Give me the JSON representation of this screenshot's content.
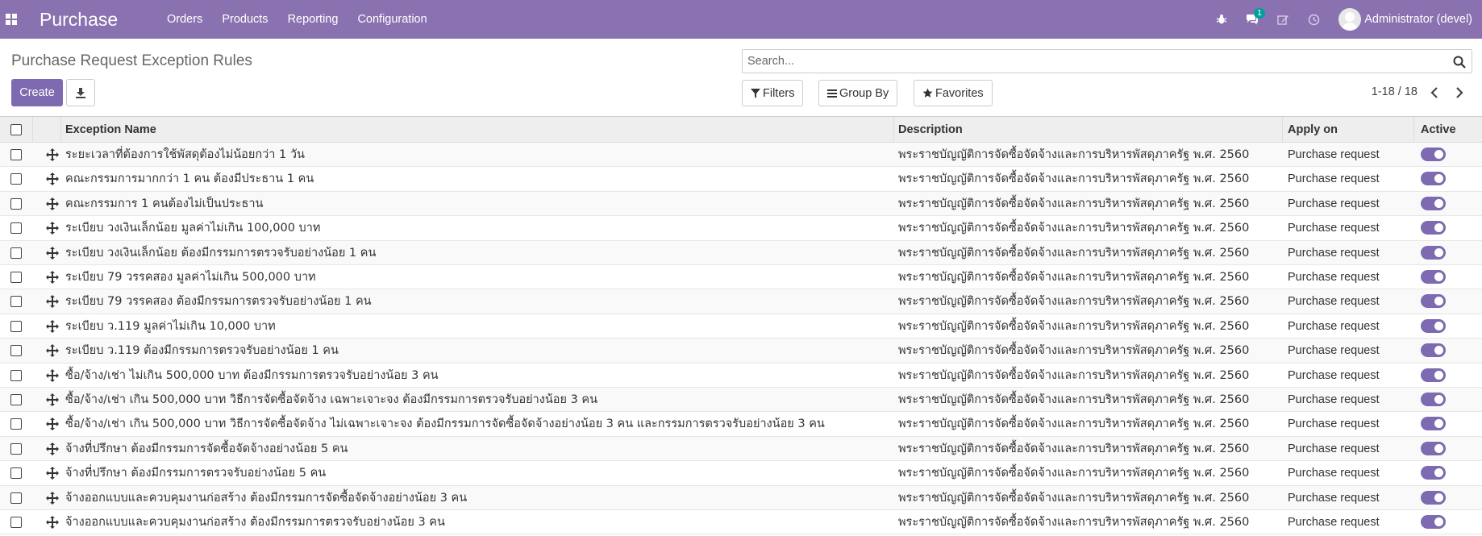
{
  "navbar": {
    "app_title": "Purchase",
    "menu": [
      "Orders",
      "Products",
      "Reporting",
      "Configuration"
    ],
    "message_count": "1",
    "user_name": "Administrator (devel)",
    "icons": [
      "apps-icon",
      "bug-icon",
      "chat-icon",
      "edit-icon",
      "clock-icon"
    ],
    "color": "#8a72b1"
  },
  "control_panel": {
    "title": "Purchase Request Exception Rules",
    "create_label": "Create",
    "search_placeholder": "Search...",
    "filters_label": "Filters",
    "group_by_label": "Group By",
    "favorites_label": "Favorites",
    "pager": "1-18 / 18"
  },
  "table": {
    "columns": [
      "Exception Name",
      "Description",
      "Apply on",
      "Active"
    ],
    "rows": [
      {
        "name": "ระยะเวลาที่ต้องการใช้พัสดุต้องไม่น้อยกว่า 1 วัน",
        "description": "พระราชบัญญัติการจัดซื้อจัดจ้างและการบริหารพัสดุภาครัฐ พ.ศ. 2560",
        "apply_on": "Purchase request",
        "active": true
      },
      {
        "name": "คณะกรรมการมากกว่า 1 คน ต้องมีประธาน 1 คน",
        "description": "พระราชบัญญัติการจัดซื้อจัดจ้างและการบริหารพัสดุภาครัฐ พ.ศ. 2560",
        "apply_on": "Purchase request",
        "active": true
      },
      {
        "name": "คณะกรรมการ 1 คนต้องไม่เป็นประธาน",
        "description": "พระราชบัญญัติการจัดซื้อจัดจ้างและการบริหารพัสดุภาครัฐ พ.ศ. 2560",
        "apply_on": "Purchase request",
        "active": true
      },
      {
        "name": "ระเบียบ วงเงินเล็กน้อย มูลค่าไม่เกิน 100,000 บาท",
        "description": "พระราชบัญญัติการจัดซื้อจัดจ้างและการบริหารพัสดุภาครัฐ พ.ศ. 2560",
        "apply_on": "Purchase request",
        "active": true
      },
      {
        "name": "ระเบียบ วงเงินเล็กน้อย ต้องมีกรรมการตรวจรับอย่างน้อย 1 คน",
        "description": "พระราชบัญญัติการจัดซื้อจัดจ้างและการบริหารพัสดุภาครัฐ พ.ศ. 2560",
        "apply_on": "Purchase request",
        "active": true
      },
      {
        "name": "ระเบียบ 79 วรรคสอง มูลค่าไม่เกิน 500,000 บาท",
        "description": "พระราชบัญญัติการจัดซื้อจัดจ้างและการบริหารพัสดุภาครัฐ พ.ศ. 2560",
        "apply_on": "Purchase request",
        "active": true
      },
      {
        "name": "ระเบียบ 79 วรรคสอง ต้องมีกรรมการตรวจรับอย่างน้อย 1 คน",
        "description": "พระราชบัญญัติการจัดซื้อจัดจ้างและการบริหารพัสดุภาครัฐ พ.ศ. 2560",
        "apply_on": "Purchase request",
        "active": true
      },
      {
        "name": "ระเบียบ ว.119 มูลค่าไม่เกิน 10,000 บาท",
        "description": "พระราชบัญญัติการจัดซื้อจัดจ้างและการบริหารพัสดุภาครัฐ พ.ศ. 2560",
        "apply_on": "Purchase request",
        "active": true
      },
      {
        "name": "ระเบียบ ว.119 ต้องมีกรรมการตรวจรับอย่างน้อย 1 คน",
        "description": "พระราชบัญญัติการจัดซื้อจัดจ้างและการบริหารพัสดุภาครัฐ พ.ศ. 2560",
        "apply_on": "Purchase request",
        "active": true
      },
      {
        "name": "ซื้อ/จ้าง/เช่า ไม่เกิน 500,000 บาท ต้องมีกรรมการตรวจรับอย่างน้อย 3 คน",
        "description": "พระราชบัญญัติการจัดซื้อจัดจ้างและการบริหารพัสดุภาครัฐ พ.ศ. 2560",
        "apply_on": "Purchase request",
        "active": true
      },
      {
        "name": "ซื้อ/จ้าง/เช่า เกิน 500,000 บาท วิธีการจัดซื้อจัดจ้าง เฉพาะเจาะจง ต้องมีกรรมการตรวจรับอย่างน้อย 3 คน",
        "description": "พระราชบัญญัติการจัดซื้อจัดจ้างและการบริหารพัสดุภาครัฐ พ.ศ. 2560",
        "apply_on": "Purchase request",
        "active": true
      },
      {
        "name": "ซื้อ/จ้าง/เช่า เกิน 500,000 บาท วิธีการจัดซื้อจัดจ้าง ไม่เฉพาะเจาะจง ต้องมีกรรมการจัดซื้อจัดจ้างอย่างน้อย 3 คน และกรรมการตรวจรับอย่างน้อย 3 คน",
        "description": "พระราชบัญญัติการจัดซื้อจัดจ้างและการบริหารพัสดุภาครัฐ พ.ศ. 2560",
        "apply_on": "Purchase request",
        "active": true
      },
      {
        "name": "จ้างที่ปรึกษา ต้องมีกรรมการจัดซื้อจัดจ้างอย่างน้อย 5 คน",
        "description": "พระราชบัญญัติการจัดซื้อจัดจ้างและการบริหารพัสดุภาครัฐ พ.ศ. 2560",
        "apply_on": "Purchase request",
        "active": true
      },
      {
        "name": "จ้างที่ปรึกษา ต้องมีกรรมการตรวจรับอย่างน้อย 5 คน",
        "description": "พระราชบัญญัติการจัดซื้อจัดจ้างและการบริหารพัสดุภาครัฐ พ.ศ. 2560",
        "apply_on": "Purchase request",
        "active": true
      },
      {
        "name": "จ้างออกแบบและควบคุมงานก่อสร้าง ต้องมีกรรมการจัดซื้อจัดจ้างอย่างน้อย 3 คน",
        "description": "พระราชบัญญัติการจัดซื้อจัดจ้างและการบริหารพัสดุภาครัฐ พ.ศ. 2560",
        "apply_on": "Purchase request",
        "active": true
      },
      {
        "name": "จ้างออกแบบและควบคุมงานก่อสร้าง ต้องมีกรรมการตรวจรับอย่างน้อย 3 คน",
        "description": "พระราชบัญญัติการจัดซื้อจัดจ้างและการบริหารพัสดุภาครัฐ พ.ศ. 2560",
        "apply_on": "Purchase request",
        "active": true
      }
    ]
  }
}
